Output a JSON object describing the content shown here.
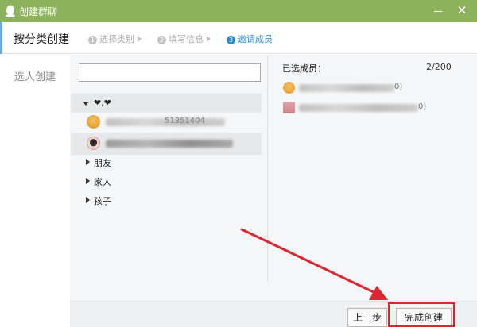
{
  "window": {
    "title": "创建群聊",
    "close_glyph": "✕"
  },
  "header": {
    "category_tab": "按分类创建",
    "steps": [
      {
        "num": "1",
        "label": "选择类别"
      },
      {
        "num": "2",
        "label": "填写信息"
      },
      {
        "num": "3",
        "label": "邀请成员"
      }
    ],
    "active_step": 3
  },
  "nav": {
    "select_people": "选人创建"
  },
  "search": {
    "value": "",
    "placeholder": ""
  },
  "tree": {
    "expanded_group": "❤,❤",
    "members": [
      {
        "suffix": "51351404",
        "avatar": "orange-cartoon-avatar"
      },
      {
        "suffix": "",
        "avatar": "girl-avatar"
      }
    ],
    "collapsed_groups": [
      "朋友",
      "家人",
      "孩子"
    ]
  },
  "selected": {
    "title": "已选成员：",
    "count": "2/200",
    "members": [
      {
        "suffix": "0)",
        "avatar": "orange-cartoon-avatar"
      },
      {
        "suffix": "0)",
        "avatar": "pink-avatar"
      }
    ]
  },
  "buttons": {
    "prev": "上一步",
    "finish": "完成创建"
  },
  "colors": {
    "titlebar": "#8cb35c",
    "active_step": "#2d8bd6",
    "annotation_red": "#d9282f"
  }
}
